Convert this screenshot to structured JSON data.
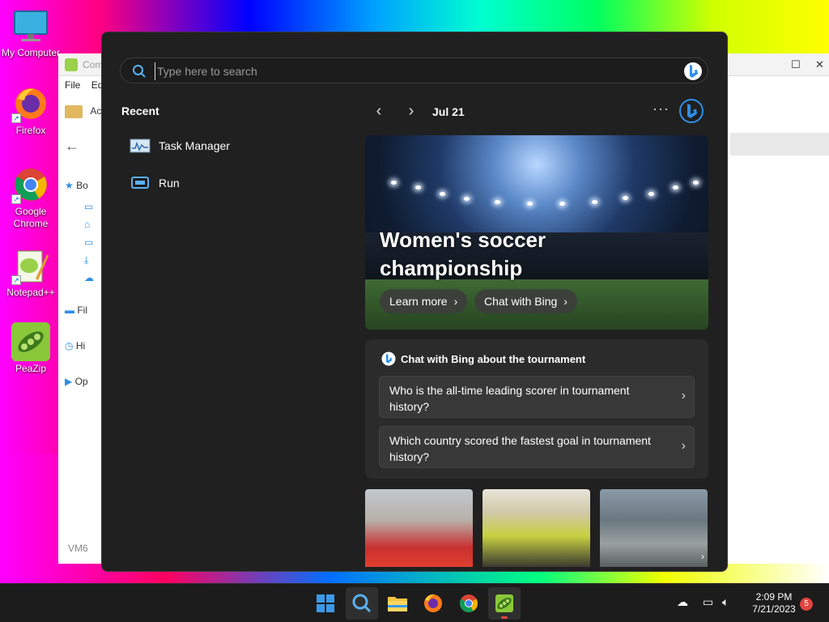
{
  "desktop": {
    "icons": [
      {
        "label": "My Computer",
        "icon": "monitor-icon"
      },
      {
        "label": "Firefox",
        "icon": "firefox-icon"
      },
      {
        "label": "Google Chrome",
        "icon": "chrome-icon"
      },
      {
        "label": "Notepad++",
        "icon": "notepadpp-icon"
      },
      {
        "label": "PeaZip",
        "icon": "peazip-icon"
      }
    ]
  },
  "background_window": {
    "title": "Com",
    "menu": [
      "File",
      "Ed"
    ],
    "address": "Ac",
    "side_items": [
      "Bo",
      "Fil",
      "Hi",
      "Op"
    ],
    "footer": "VM6"
  },
  "search": {
    "placeholder": "Type here to search",
    "recent_title": "Recent",
    "recent_items": [
      {
        "label": "Task Manager",
        "icon": "task-manager-icon"
      },
      {
        "label": "Run",
        "icon": "run-icon"
      }
    ],
    "date": "Jul 21",
    "more": "···",
    "hero": {
      "title": "Women's soccer championship",
      "learn_more": "Learn more",
      "chat_with_bing": "Chat with Bing"
    },
    "chat_card": {
      "heading": "Chat with Bing about the tournament",
      "questions": [
        "Who is the all-time leading scorer in tournament history?",
        "Which country scored the fastest goal in tournament history?"
      ]
    }
  },
  "taskbar": {
    "apps": [
      "start-icon",
      "search-icon",
      "file-explorer-icon",
      "firefox-icon",
      "chrome-icon",
      "peazip-icon"
    ],
    "time": "2:09 PM",
    "date": "7/21/2023",
    "notification_count": "5"
  },
  "colors": {
    "flyout_bg": "#202020",
    "card_bg": "#2b2b2b",
    "bing_blue": "#2e8fe6",
    "taskbar_bg": "#1c1c1c"
  }
}
